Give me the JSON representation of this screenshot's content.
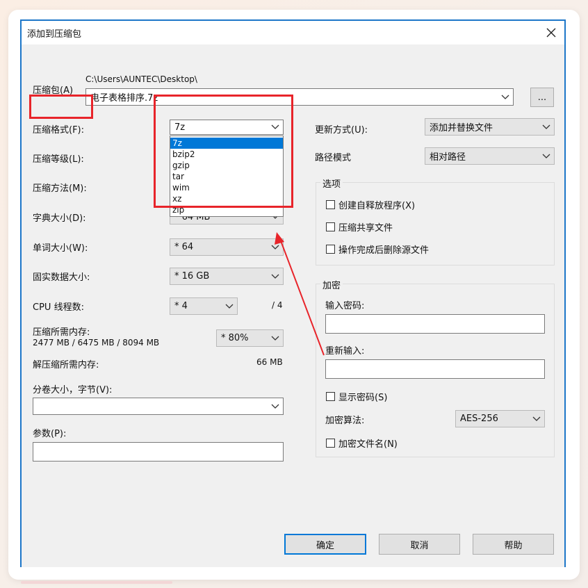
{
  "window": {
    "title": "添加到压缩包"
  },
  "archive": {
    "label": "压缩包(A)",
    "path": "C:\\Users\\AUNTEC\\Desktop\\",
    "filename": "电子表格排序.7z",
    "browse_label": "..."
  },
  "left": {
    "format": {
      "label": "压缩格式(F):",
      "value": "7z"
    },
    "format_options": [
      "7z",
      "bzip2",
      "gzip",
      "tar",
      "wim",
      "xz",
      "zip"
    ],
    "level": {
      "label": "压缩等级(L):"
    },
    "method": {
      "label": "压缩方法(M):"
    },
    "dict": {
      "label": "字典大小(D):",
      "value": "* 64 MB"
    },
    "word": {
      "label": "单词大小(W):",
      "value": "* 64"
    },
    "solid": {
      "label": "固实数据大小:",
      "value": "* 16 GB"
    },
    "threads": {
      "label": "CPU 线程数:",
      "value": "* 4",
      "max": "/ 4"
    },
    "mem": {
      "label": "压缩所需内存:",
      "detail": "2477 MB / 6475 MB / 8094 MB",
      "value": "* 80%"
    },
    "decomp": {
      "label": "解压缩所需内存:",
      "value": "66 MB"
    },
    "split": {
      "label": "分卷大小，字节(V):",
      "value": ""
    },
    "params": {
      "label": "参数(P):",
      "value": ""
    }
  },
  "right": {
    "update": {
      "label": "更新方式(U):",
      "value": "添加并替换文件"
    },
    "pathmode": {
      "label": "路径模式",
      "value": "相对路径"
    },
    "options": {
      "title": "选项",
      "sfx": "创建自释放程序(X)",
      "shared": "压缩共享文件",
      "delete": "操作完成后删除源文件"
    },
    "encrypt": {
      "title": "加密",
      "pw_label": "输入密码:",
      "pw2_label": "重新输入:",
      "show": "显示密码(S)",
      "algo_label": "加密算法:",
      "algo_value": "AES-256",
      "names": "加密文件名(N)"
    }
  },
  "buttons": {
    "ok": "确定",
    "cancel": "取消",
    "help": "帮助"
  },
  "colors": {
    "annotation": "#e8242a",
    "selection": "#0078d7",
    "dialog_border": "#1c76c8"
  }
}
